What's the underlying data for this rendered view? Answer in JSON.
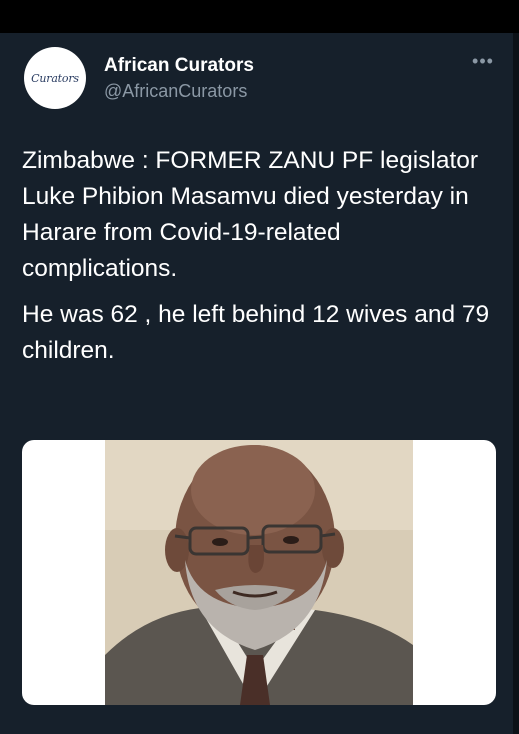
{
  "author": {
    "display_name": "African Curators",
    "handle": "@AfricanCurators",
    "avatar_text": "Curators"
  },
  "menu": {
    "more_label": "•••"
  },
  "tweet": {
    "paragraph_1": "Zimbabwe : FORMER ZANU PF legislator Luke Phibion Masamvu died yesterday in Harare from Covid-19-related complications.",
    "paragraph_2": "He was 62 , he left behind 12 wives and 79 children."
  },
  "media": {
    "icon": "photo-of-man-icon"
  },
  "colors": {
    "background": "#16202b",
    "text": "#ffffff",
    "secondary_text": "#8b98a5"
  }
}
